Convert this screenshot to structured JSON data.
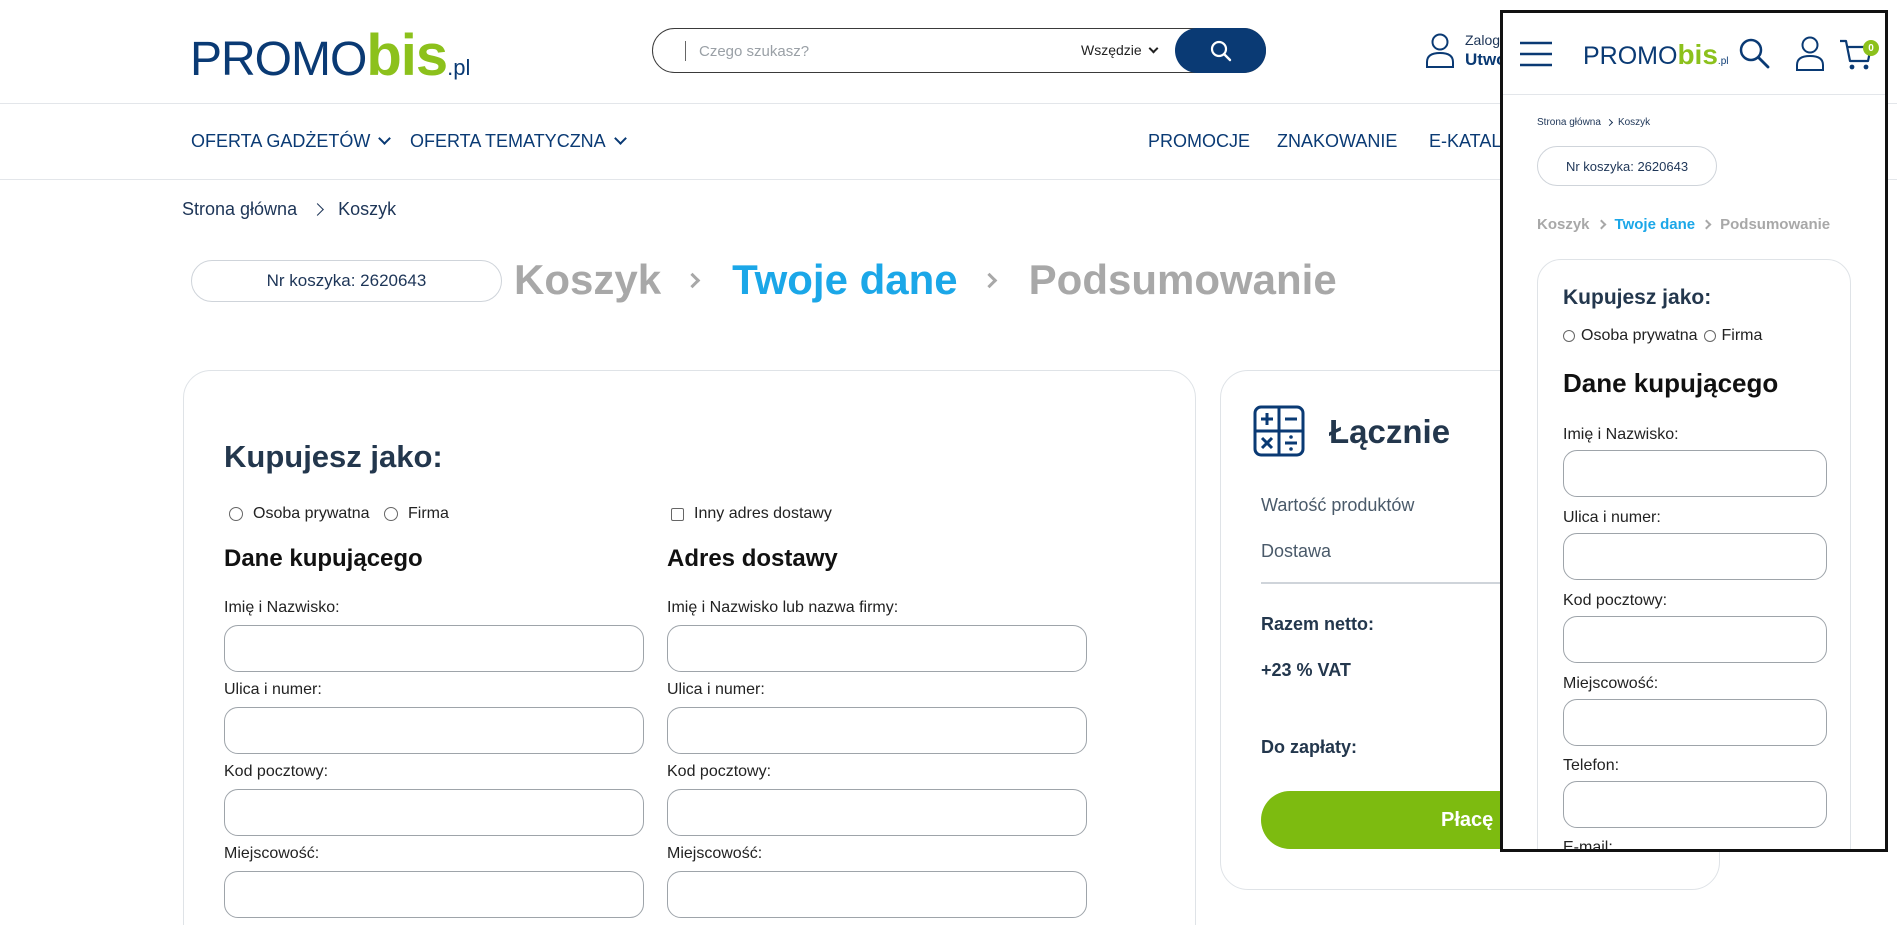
{
  "header": {
    "logo": {
      "promo": "PROMO",
      "bis": "bis",
      "pl": ".pl"
    },
    "search": {
      "placeholder": "Czego szukasz?",
      "scope": "Wszędzie"
    },
    "account": {
      "line1": "Zalogu",
      "line2": "Utwó"
    }
  },
  "nav": {
    "left": [
      "OFERTA GADŻETÓW",
      "OFERTA TEMATYCZNA"
    ],
    "right": [
      "PROMOCJE",
      "ZNAKOWANIE",
      "E-KATALO"
    ]
  },
  "breadcrumb": [
    "Strona główna",
    "Koszyk"
  ],
  "cart_number": "Nr koszyka: 2620643",
  "steps": [
    "Koszyk",
    "Twoje dane",
    "Podsumowanie"
  ],
  "form": {
    "buy_as_title": "Kupujesz jako:",
    "buy_as_options": [
      "Osoba prywatna",
      "Firma"
    ],
    "other_address": "Inny adres dostawy",
    "buyer_title": "Dane kupującego",
    "buyer_fields": [
      "Imię i Nazwisko:",
      "Ulica i numer:",
      "Kod pocztowy:",
      "Miejscowość:"
    ],
    "delivery_title": "Adres dostawy",
    "delivery_fields": [
      "Imię i Nazwisko lub nazwa firmy:",
      "Ulica i numer:",
      "Kod pocztowy:",
      "Miejscowość:"
    ]
  },
  "summary": {
    "title": "Łącznie",
    "rows": [
      "Wartość produktów",
      "Dostawa"
    ],
    "net": "Razem netto:",
    "vat": "+23 % VAT",
    "total": "Do zapłaty:",
    "pay_button": "Płacę"
  },
  "mobile": {
    "logo": {
      "promo": "PROMO",
      "bis": "bis",
      "pl": ".pl"
    },
    "cart_count": "0",
    "breadcrumb": [
      "Strona główna",
      "Koszyk"
    ],
    "cart_number": "Nr koszyka: 2620643",
    "steps": [
      "Koszyk",
      "Twoje dane",
      "Podsumowanie"
    ],
    "buy_as_title": "Kupujesz jako:",
    "buy_as_options": [
      "Osoba prywatna",
      "Firma"
    ],
    "buyer_title": "Dane kupującego",
    "fields": [
      "Imię i Nazwisko:",
      "Ulica i numer:",
      "Kod pocztowy:",
      "Miejscowość:",
      "Telefon:",
      "E-mail:"
    ]
  },
  "colors": {
    "navy": "#0a3a74",
    "green": "#8cc11c",
    "active_step": "#1ba7e8",
    "pay_button": "#7dbb10"
  }
}
